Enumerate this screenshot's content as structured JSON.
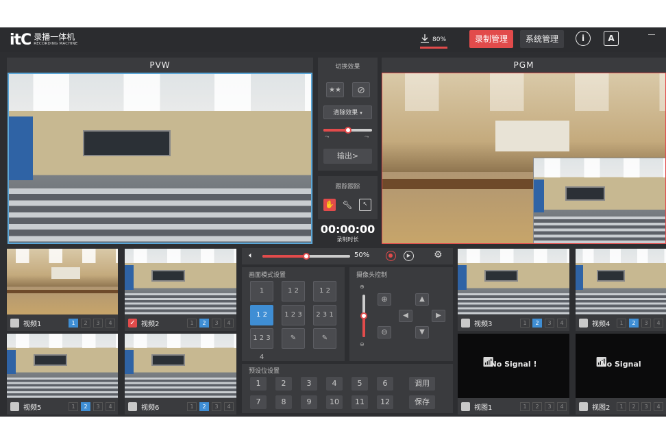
{
  "topbar": {
    "logo_mark": "itC",
    "logo_title": "录播一体机",
    "logo_sub": "RECORDING MACHINE",
    "download_pct": "80%",
    "btn_record": "录制管理",
    "btn_system": "系统管理"
  },
  "pvw": {
    "title": "PVW"
  },
  "pgm": {
    "title": "PGM"
  },
  "switch": {
    "title": "切换效果",
    "clear_label": "清除效果",
    "output_label": "输出>",
    "slider_fraction": 0.5
  },
  "tracking": {
    "title": "跟踪跟踪"
  },
  "timer": {
    "time": "00:00:00",
    "label": "录制时长"
  },
  "volume": {
    "pct_label": "50%",
    "fraction": 0.5
  },
  "layout": {
    "title": "画面模式设置",
    "modes": [
      "1",
      "1 2",
      "1 2",
      "1 2",
      "1 2 3",
      "2 3 1",
      "1 2 3 4",
      "",
      ""
    ]
  },
  "ptz": {
    "title": "摄像头控制",
    "zoom_fraction": 0.5
  },
  "presets": {
    "title": "预设位设置",
    "numbers": [
      "1",
      "2",
      "3",
      "4",
      "5",
      "6",
      "7",
      "8",
      "9",
      "10",
      "11",
      "12"
    ],
    "call_label": "调用",
    "save_label": "保存"
  },
  "thumbs": [
    {
      "name": "视频1",
      "checked": false,
      "active": 1
    },
    {
      "name": "视频2",
      "checked": true,
      "active": 2
    },
    {
      "name": "视频3",
      "checked": false,
      "active": 2
    },
    {
      "name": "视频4",
      "checked": false,
      "active": 2
    },
    {
      "name": "视频5",
      "checked": false,
      "active": 2
    },
    {
      "name": "视频6",
      "checked": false,
      "active": 2
    },
    {
      "name": "视图1",
      "checked": false,
      "active": 0,
      "nosignal": "No Signal !"
    },
    {
      "name": "视图2",
      "checked": false,
      "active": 0,
      "nosignal": "No Signal"
    }
  ],
  "thumb_nums": [
    "1",
    "2",
    "3",
    "4"
  ],
  "colors": {
    "accent_red": "#e24b4b",
    "accent_blue": "#3f8ed4",
    "panel": "#3a3b3e",
    "bg": "#2d2e31"
  }
}
